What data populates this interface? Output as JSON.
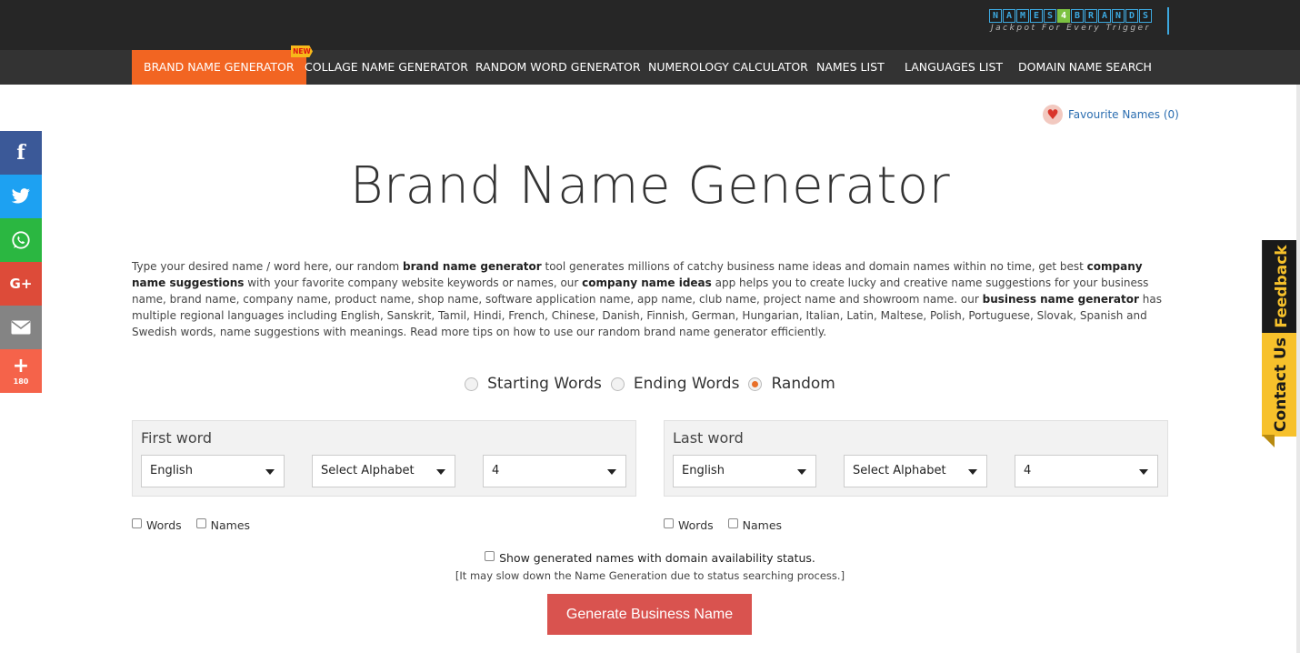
{
  "logo": {
    "letters": [
      "N",
      "A",
      "M",
      "E",
      "S",
      "4",
      "B",
      "R",
      "A",
      "N",
      "D",
      "S"
    ],
    "tagline": "Jackpot For Every Trigger"
  },
  "nav": {
    "items": [
      {
        "label": "BRAND NAME GENERATOR",
        "active": true
      },
      {
        "label": "COLLAGE NAME GENERATOR"
      },
      {
        "label": "RANDOM WORD GENERATOR"
      },
      {
        "label": "NUMEROLOGY CALCULATOR"
      },
      {
        "label": "NAMES LIST"
      },
      {
        "label": "LANGUAGES LIST"
      },
      {
        "label": "DOMAIN NAME SEARCH"
      }
    ],
    "new_badge": "NEW"
  },
  "social": {
    "share_count": "180",
    "icons": [
      "facebook-icon",
      "twitter-icon",
      "whatsapp-icon",
      "google-plus-icon",
      "email-icon",
      "more-share-icon"
    ]
  },
  "favourites": {
    "label": "Favourite Names (0)"
  },
  "page": {
    "title": "Brand Name Generator",
    "description": [
      {
        "t": "Type your desired name / word here, our random "
      },
      {
        "t": "brand name generator",
        "b": true
      },
      {
        "t": " tool generates millions of catchy business name ideas and domain names within no time, get best "
      },
      {
        "t": "company name suggestions",
        "b": true
      },
      {
        "t": " with your favorite company website keywords or names, our "
      },
      {
        "t": "company name ideas",
        "b": true
      },
      {
        "t": " app helps you to create lucky and creative name suggestions for your business name, brand name, company name, product name, shop name, software application name, app name, club name, project name and showroom name. our "
      },
      {
        "t": "business name generator",
        "b": true
      },
      {
        "t": " has multiple regional languages including English, Sanskrit, Tamil, Hindi, French, Chinese, Danish, Finnish, German, Hungarian, Italian, Latin, Maltese, Polish, Portuguese, Slovak, Spanish and Swedish words, name suggestions with meanings. Read more tips on how to use our random brand name generator efficiently."
      }
    ]
  },
  "mode": {
    "options": [
      "Starting Words",
      "Ending Words",
      "Random"
    ],
    "selected": "Random"
  },
  "first_word": {
    "label": "First word",
    "language": "English",
    "alphabet": "Select Alphabet",
    "length": "4",
    "checks": [
      "Words",
      "Names"
    ]
  },
  "last_word": {
    "label": "Last word",
    "language": "English",
    "alphabet": "Select Alphabet",
    "length": "4",
    "checks": [
      "Words",
      "Names"
    ]
  },
  "domain": {
    "label": "Show generated names with domain availability status.",
    "note": "[It may slow down the Name Generation due to status searching process.]"
  },
  "generate_button": "Generate Business Name",
  "side_tabs": {
    "feedback": "Feedback",
    "contact": "Contact Us"
  },
  "colors": {
    "accent": "#f26522",
    "button": "#d9534f",
    "nav_bg": "#333333",
    "tab_yellow": "#f7c12b"
  }
}
